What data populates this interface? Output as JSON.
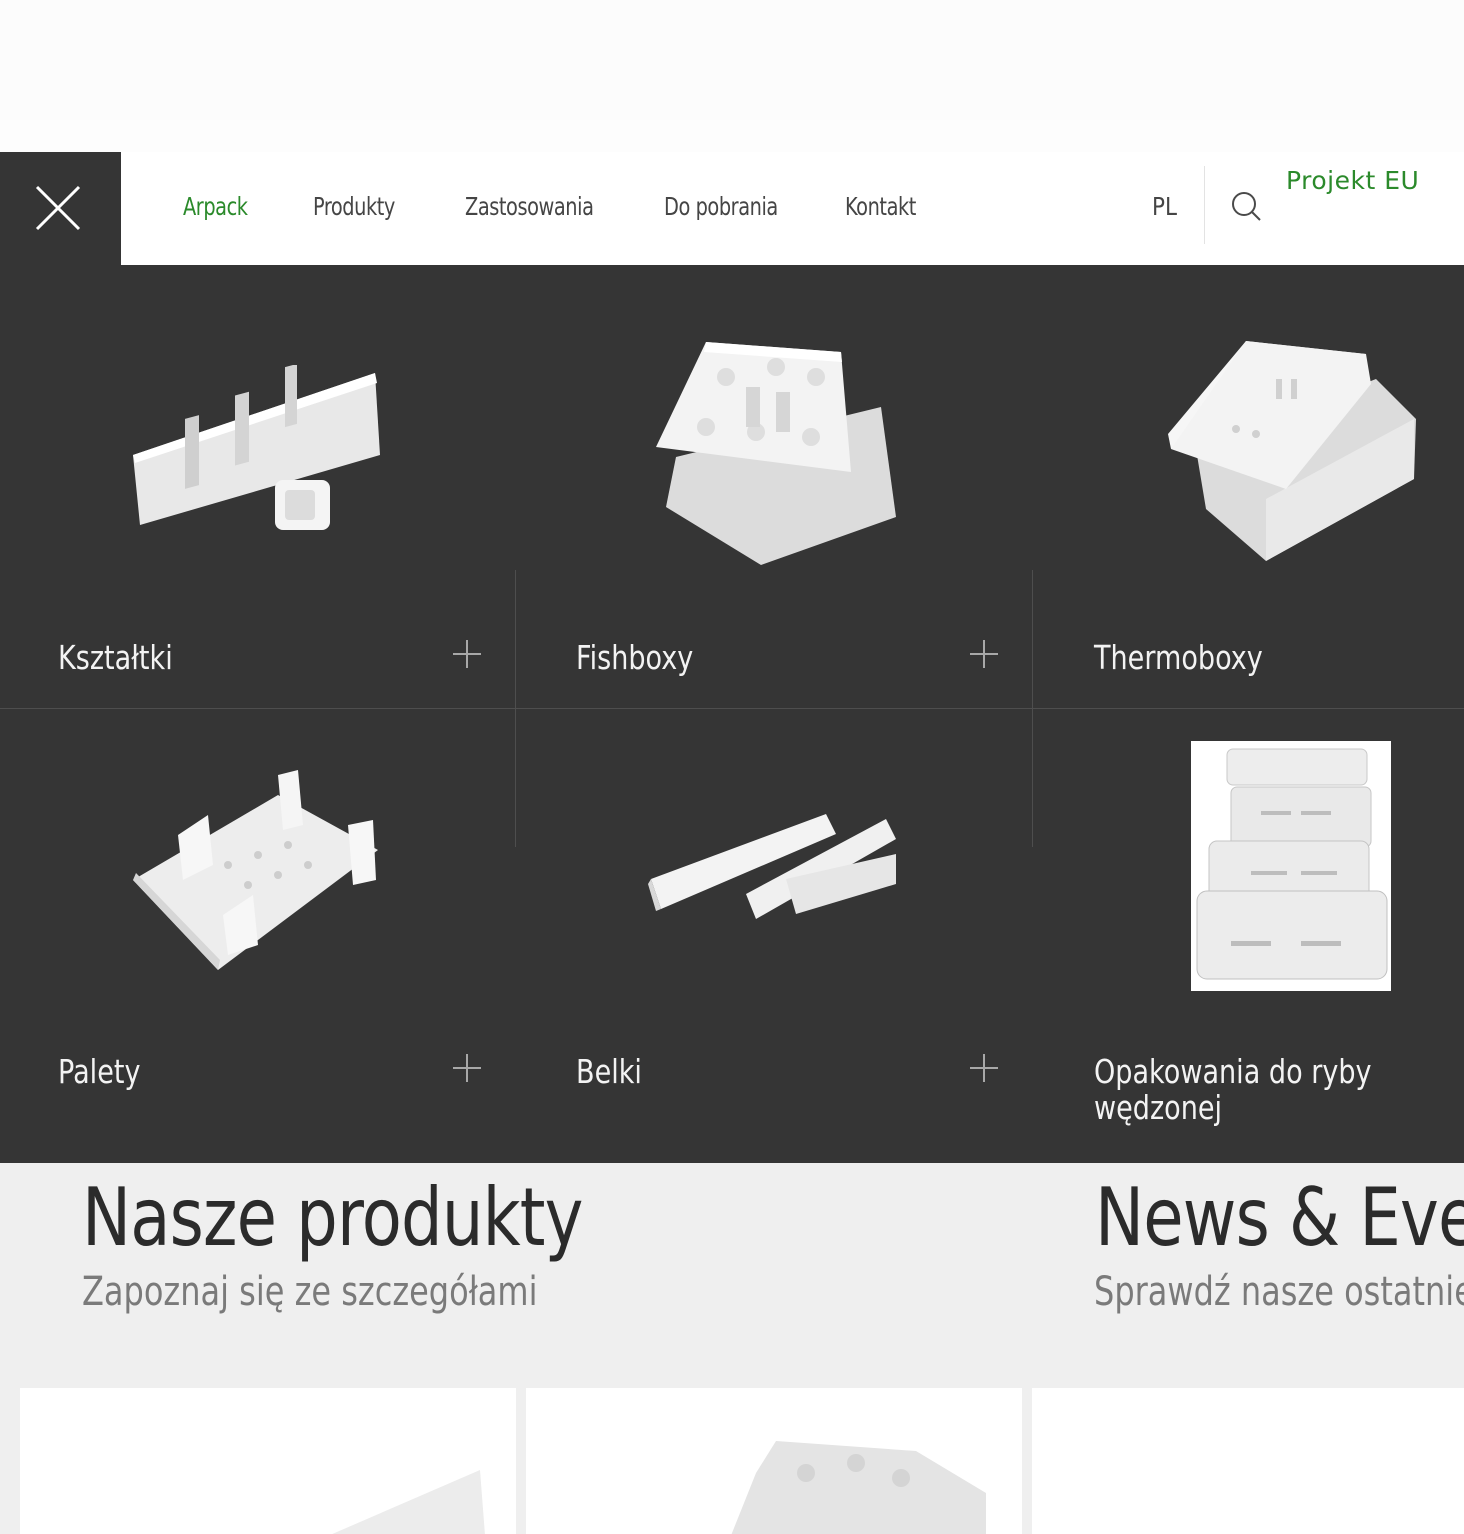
{
  "nav": {
    "items": [
      {
        "label": "Arpack",
        "active": true
      },
      {
        "label": "Produkty",
        "active": false
      },
      {
        "label": "Zastosowania",
        "active": false
      },
      {
        "label": "Do pobrania",
        "active": false
      },
      {
        "label": "Kontakt",
        "active": false
      }
    ],
    "language": "PL",
    "eu_link": "Projekt EU",
    "close_icon": "close-icon",
    "search_icon": "search-icon"
  },
  "products_menu": [
    {
      "label": "Kształtki",
      "expandable": true
    },
    {
      "label": "Fishboxy",
      "expandable": true
    },
    {
      "label": "Thermoboxy",
      "expandable": false
    },
    {
      "label": "Palety",
      "expandable": true
    },
    {
      "label": "Belki",
      "expandable": true
    },
    {
      "label": "Opakowania do ryby wędzonej",
      "expandable": false
    }
  ],
  "sections": {
    "products": {
      "title": "Nasze produkty",
      "subtitle": "Zapoznaj się ze szczegółami"
    },
    "news": {
      "title": "News & Events",
      "subtitle": "Sprawdź nasze ostatnie wydarzenia"
    }
  },
  "colors": {
    "accent": "#2b8a2b",
    "panel": "#353535",
    "text": "#454545"
  }
}
